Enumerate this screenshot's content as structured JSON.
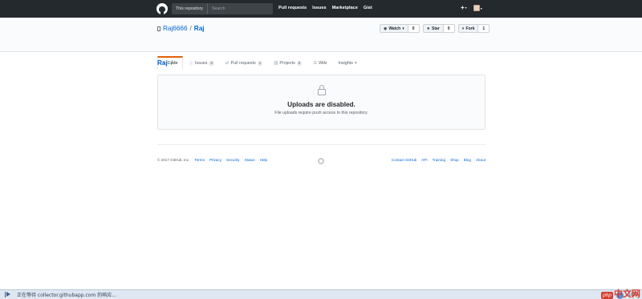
{
  "header": {
    "search_scope": "This repository",
    "search_placeholder": "Search",
    "nav": [
      "Pull requests",
      "Issues",
      "Marketplace",
      "Gist"
    ],
    "plus_label": "+",
    "icons": {
      "logo": "github-mark",
      "plus": "plus-icon",
      "avatar": "user-avatar"
    }
  },
  "repo": {
    "owner": "Raj6666",
    "separator": "/",
    "name": "Raj"
  },
  "actions": [
    {
      "label": "Watch",
      "glyph": "◉",
      "caret": "▾",
      "count": "0"
    },
    {
      "label": "Star",
      "glyph": "★",
      "caret": "",
      "count": "0"
    },
    {
      "label": "Fork",
      "glyph": "⑂",
      "caret": "",
      "count": "1"
    }
  ],
  "tabs": [
    {
      "label": "Code",
      "glyph": "‹›",
      "counter": "",
      "selected": true
    },
    {
      "label": "Issues",
      "glyph": "ⓘ",
      "counter": "0",
      "selected": false
    },
    {
      "label": "Pull requests",
      "glyph": "⇄",
      "counter": "1",
      "selected": false
    },
    {
      "label": "Projects",
      "glyph": "▥",
      "counter": "0",
      "selected": false
    },
    {
      "label": "Wiki",
      "glyph": "☰",
      "counter": "",
      "selected": false
    },
    {
      "label": "Insights",
      "glyph": "",
      "counter": "",
      "caret": "▾",
      "selected": false
    }
  ],
  "breadcrumb": {
    "repo": "Raj",
    "slash": "/"
  },
  "blankslate": {
    "title": "Uploads are disabled.",
    "description": "File uploads require push access to this repository."
  },
  "footer": {
    "copyright": "© 2017 GitHub, Inc.",
    "left_links": [
      "Terms",
      "Privacy",
      "Security",
      "Status",
      "Help"
    ],
    "right_links": [
      "Contact GitHub",
      "API",
      "Training",
      "Shop",
      "Blog",
      "About"
    ]
  },
  "statusbar": {
    "text": "正在等待 collector.githubapp.com 的响应...",
    "zoom": "100%"
  },
  "watermark": {
    "php": "php",
    "cn": "中文网"
  },
  "colors": {
    "header_bg": "#24292e",
    "link": "#0366d6",
    "tab_accent": "#e36209"
  }
}
